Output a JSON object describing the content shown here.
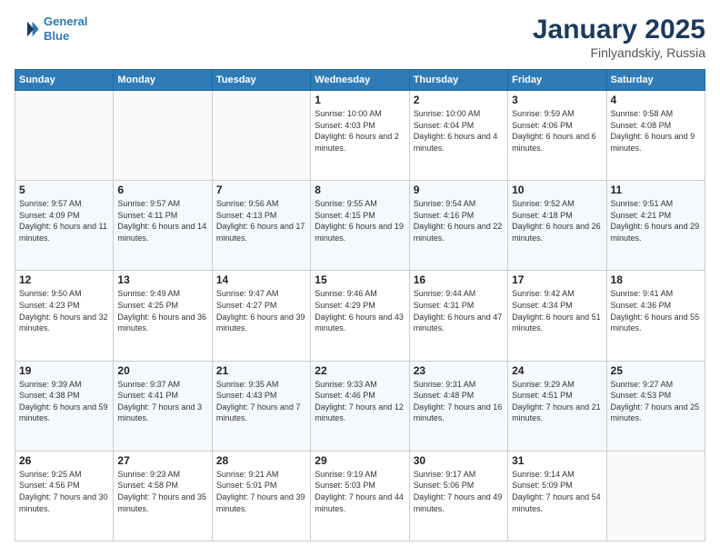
{
  "logo": {
    "line1": "General",
    "line2": "Blue"
  },
  "title": "January 2025",
  "location": "Finlyandskiy, Russia",
  "weekdays": [
    "Sunday",
    "Monday",
    "Tuesday",
    "Wednesday",
    "Thursday",
    "Friday",
    "Saturday"
  ],
  "weeks": [
    [
      {
        "day": "",
        "info": ""
      },
      {
        "day": "",
        "info": ""
      },
      {
        "day": "",
        "info": ""
      },
      {
        "day": "1",
        "info": "Sunrise: 10:00 AM\nSunset: 4:03 PM\nDaylight: 6 hours and 2 minutes."
      },
      {
        "day": "2",
        "info": "Sunrise: 10:00 AM\nSunset: 4:04 PM\nDaylight: 6 hours and 4 minutes."
      },
      {
        "day": "3",
        "info": "Sunrise: 9:59 AM\nSunset: 4:06 PM\nDaylight: 6 hours and 6 minutes."
      },
      {
        "day": "4",
        "info": "Sunrise: 9:58 AM\nSunset: 4:08 PM\nDaylight: 6 hours and 9 minutes."
      }
    ],
    [
      {
        "day": "5",
        "info": "Sunrise: 9:57 AM\nSunset: 4:09 PM\nDaylight: 6 hours and 11 minutes."
      },
      {
        "day": "6",
        "info": "Sunrise: 9:57 AM\nSunset: 4:11 PM\nDaylight: 6 hours and 14 minutes."
      },
      {
        "day": "7",
        "info": "Sunrise: 9:56 AM\nSunset: 4:13 PM\nDaylight: 6 hours and 17 minutes."
      },
      {
        "day": "8",
        "info": "Sunrise: 9:55 AM\nSunset: 4:15 PM\nDaylight: 6 hours and 19 minutes."
      },
      {
        "day": "9",
        "info": "Sunrise: 9:54 AM\nSunset: 4:16 PM\nDaylight: 6 hours and 22 minutes."
      },
      {
        "day": "10",
        "info": "Sunrise: 9:52 AM\nSunset: 4:18 PM\nDaylight: 6 hours and 26 minutes."
      },
      {
        "day": "11",
        "info": "Sunrise: 9:51 AM\nSunset: 4:21 PM\nDaylight: 6 hours and 29 minutes."
      }
    ],
    [
      {
        "day": "12",
        "info": "Sunrise: 9:50 AM\nSunset: 4:23 PM\nDaylight: 6 hours and 32 minutes."
      },
      {
        "day": "13",
        "info": "Sunrise: 9:49 AM\nSunset: 4:25 PM\nDaylight: 6 hours and 36 minutes."
      },
      {
        "day": "14",
        "info": "Sunrise: 9:47 AM\nSunset: 4:27 PM\nDaylight: 6 hours and 39 minutes."
      },
      {
        "day": "15",
        "info": "Sunrise: 9:46 AM\nSunset: 4:29 PM\nDaylight: 6 hours and 43 minutes."
      },
      {
        "day": "16",
        "info": "Sunrise: 9:44 AM\nSunset: 4:31 PM\nDaylight: 6 hours and 47 minutes."
      },
      {
        "day": "17",
        "info": "Sunrise: 9:42 AM\nSunset: 4:34 PM\nDaylight: 6 hours and 51 minutes."
      },
      {
        "day": "18",
        "info": "Sunrise: 9:41 AM\nSunset: 4:36 PM\nDaylight: 6 hours and 55 minutes."
      }
    ],
    [
      {
        "day": "19",
        "info": "Sunrise: 9:39 AM\nSunset: 4:38 PM\nDaylight: 6 hours and 59 minutes."
      },
      {
        "day": "20",
        "info": "Sunrise: 9:37 AM\nSunset: 4:41 PM\nDaylight: 7 hours and 3 minutes."
      },
      {
        "day": "21",
        "info": "Sunrise: 9:35 AM\nSunset: 4:43 PM\nDaylight: 7 hours and 7 minutes."
      },
      {
        "day": "22",
        "info": "Sunrise: 9:33 AM\nSunset: 4:46 PM\nDaylight: 7 hours and 12 minutes."
      },
      {
        "day": "23",
        "info": "Sunrise: 9:31 AM\nSunset: 4:48 PM\nDaylight: 7 hours and 16 minutes."
      },
      {
        "day": "24",
        "info": "Sunrise: 9:29 AM\nSunset: 4:51 PM\nDaylight: 7 hours and 21 minutes."
      },
      {
        "day": "25",
        "info": "Sunrise: 9:27 AM\nSunset: 4:53 PM\nDaylight: 7 hours and 25 minutes."
      }
    ],
    [
      {
        "day": "26",
        "info": "Sunrise: 9:25 AM\nSunset: 4:56 PM\nDaylight: 7 hours and 30 minutes."
      },
      {
        "day": "27",
        "info": "Sunrise: 9:23 AM\nSunset: 4:58 PM\nDaylight: 7 hours and 35 minutes."
      },
      {
        "day": "28",
        "info": "Sunrise: 9:21 AM\nSunset: 5:01 PM\nDaylight: 7 hours and 39 minutes."
      },
      {
        "day": "29",
        "info": "Sunrise: 9:19 AM\nSunset: 5:03 PM\nDaylight: 7 hours and 44 minutes."
      },
      {
        "day": "30",
        "info": "Sunrise: 9:17 AM\nSunset: 5:06 PM\nDaylight: 7 hours and 49 minutes."
      },
      {
        "day": "31",
        "info": "Sunrise: 9:14 AM\nSunset: 5:09 PM\nDaylight: 7 hours and 54 minutes."
      },
      {
        "day": "",
        "info": ""
      }
    ]
  ]
}
